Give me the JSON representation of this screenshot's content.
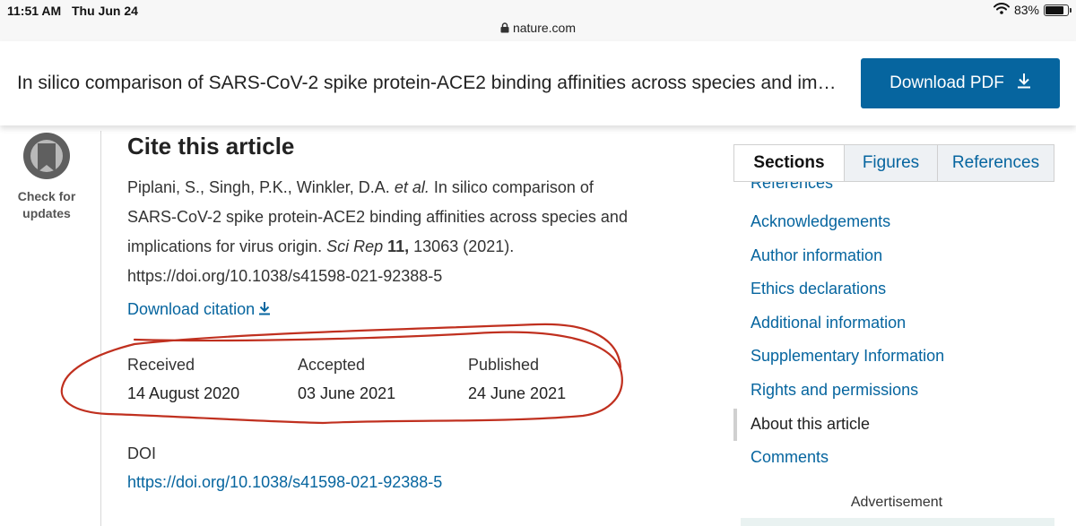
{
  "status_bar": {
    "time": "11:51 AM",
    "date": "Thu Jun 24",
    "url": "nature.com",
    "battery": "83%",
    "battery_level": 0.83
  },
  "header": {
    "title": "In silico comparison of SARS-CoV-2 spike protein-ACE2 binding affinities across species and im…",
    "download_pdf": "Download PDF"
  },
  "check_updates": {
    "line1": "Check for",
    "line2": "updates"
  },
  "cite": {
    "heading": "Cite this article",
    "authors": "Piplani, S., Singh, P.K., Winkler, D.A. ",
    "et_al": "et al.",
    "title_text": " In silico comparison of SARS-CoV-2 spike protein-ACE2 binding affinities across species and implications for virus origin. ",
    "journal": "Sci Rep",
    "volume": "11,",
    "pages_year": " 13063 (2021).",
    "doi_url": "https://doi.org/10.1038/s41598-021-92388-5",
    "download_citation": "Download citation"
  },
  "dates": [
    {
      "label": "Received",
      "value": "14 August 2020"
    },
    {
      "label": "Accepted",
      "value": "03 June 2021"
    },
    {
      "label": "Published",
      "value": "24 June 2021"
    }
  ],
  "doi": {
    "label": "DOI",
    "link": "https://doi.org/10.1038/s41598-021-92388-5"
  },
  "tabs": [
    {
      "label": "Sections"
    },
    {
      "label": "Figures"
    },
    {
      "label": "References"
    }
  ],
  "sections": [
    {
      "label": "References"
    },
    {
      "label": "Acknowledgements"
    },
    {
      "label": "Author information"
    },
    {
      "label": "Ethics declarations"
    },
    {
      "label": "Additional information"
    },
    {
      "label": "Supplementary Information"
    },
    {
      "label": "Rights and permissions"
    },
    {
      "label": "About this article"
    },
    {
      "label": "Comments"
    }
  ],
  "advertisement_label": "Advertisement",
  "colors": {
    "brand_blue": "#06659f",
    "annotation_red": "#c0301f"
  },
  "icons": [
    "lock-icon",
    "wifi-icon",
    "battery-icon",
    "download-icon",
    "check-for-updates-icon"
  ]
}
